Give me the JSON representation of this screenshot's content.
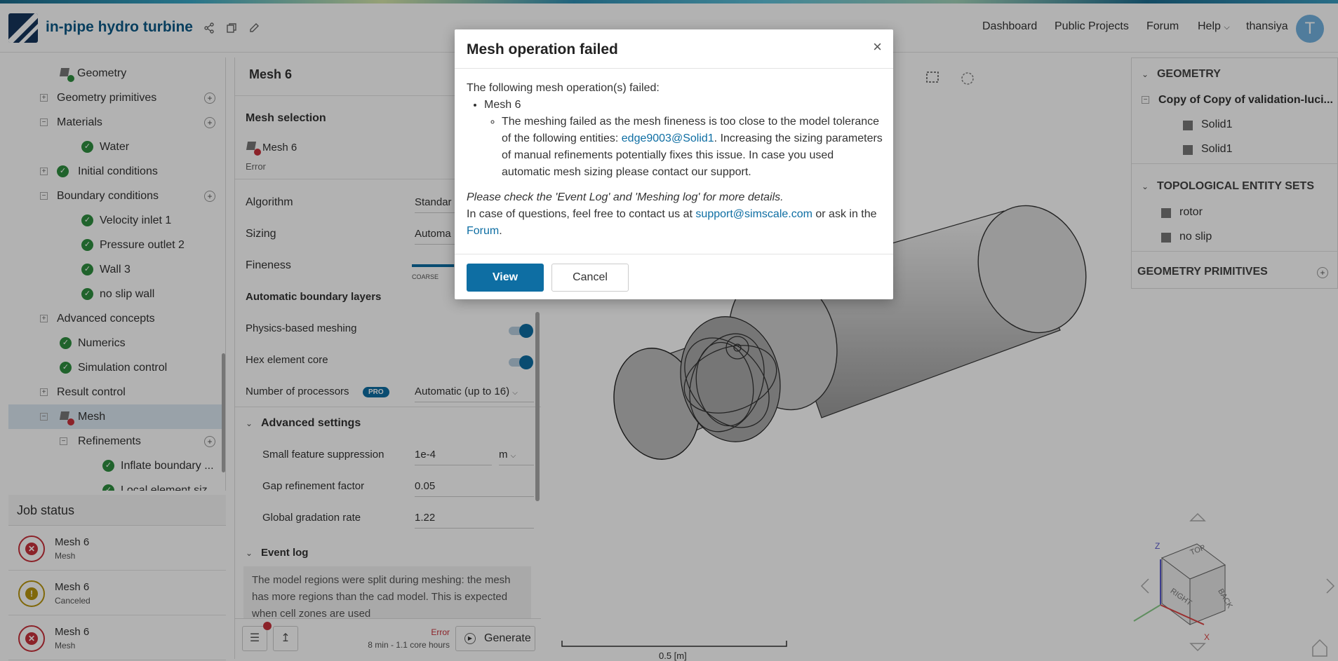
{
  "header": {
    "project_title": "in-pipe hydro turbine",
    "nav": [
      "Dashboard",
      "Public Projects",
      "Forum",
      "Help",
      "thansiya"
    ],
    "avatar_initial": "T"
  },
  "tree": {
    "items": [
      {
        "label": "Geometry"
      },
      {
        "label": "Geometry primitives"
      },
      {
        "label": "Materials"
      },
      {
        "label": "Water"
      },
      {
        "label": "Initial conditions"
      },
      {
        "label": "Boundary conditions"
      },
      {
        "label": "Velocity inlet 1"
      },
      {
        "label": "Pressure outlet 2"
      },
      {
        "label": "Wall 3"
      },
      {
        "label": "no slip wall"
      },
      {
        "label": "Advanced concepts"
      },
      {
        "label": "Numerics"
      },
      {
        "label": "Simulation control"
      },
      {
        "label": "Result control"
      },
      {
        "label": "Mesh"
      },
      {
        "label": "Refinements"
      },
      {
        "label": "Inflate boundary ..."
      },
      {
        "label": "Local element siz..."
      }
    ]
  },
  "job_status": {
    "title": "Job status",
    "jobs": [
      {
        "name": "Mesh 6",
        "sub": "Mesh",
        "state": "error"
      },
      {
        "name": "Mesh 6",
        "sub": "Canceled",
        "state": "warning"
      },
      {
        "name": "Mesh 6",
        "sub": "Mesh",
        "state": "error"
      }
    ]
  },
  "mesh_panel": {
    "title": "Mesh 6",
    "mesh_selection_label": "Mesh selection",
    "selected_mesh": "Mesh 6",
    "selected_status": "Error",
    "algorithm_label": "Algorithm",
    "algorithm_value": "Standar",
    "sizing_label": "Sizing",
    "sizing_value": "Automa",
    "fineness_label": "Fineness",
    "fineness_scale_left": "COARSE",
    "auto_boundary_layers_label": "Automatic boundary layers",
    "physics_meshing_label": "Physics-based meshing",
    "hex_core_label": "Hex element core",
    "processors_label": "Number of processors",
    "pro_badge": "PRO",
    "processors_value": "Automatic (up to 16)",
    "advanced_settings_label": "Advanced settings",
    "small_feature_label": "Small feature suppression",
    "small_feature_value": "1e-4",
    "small_feature_unit": "m",
    "gap_refinement_label": "Gap refinement factor",
    "gap_refinement_value": "0.05",
    "gradation_label": "Global gradation rate",
    "gradation_value": "1.22",
    "event_log_label": "Event log",
    "event_log_text": "The model regions were split during meshing: the mesh has more regions than the cad model. This is expected when cell zones are used",
    "footer_status": "Error",
    "footer_time": "8 min - 1.1 core hours",
    "generate_label": "Generate"
  },
  "right_panel": {
    "geometry_title": "GEOMETRY",
    "geometry_root": "Copy of Copy of validation-luci...",
    "solids": [
      "Solid1",
      "Solid1"
    ],
    "topo_title": "TOPOLOGICAL ENTITY SETS",
    "topo_items": [
      "rotor",
      "no slip"
    ],
    "primitives_title": "GEOMETRY PRIMITIVES"
  },
  "viewer": {
    "scale_label": "0.5 [m]",
    "nav_cube_faces": [
      "TOP",
      "RIGHT",
      "BACK"
    ],
    "axes": [
      "Z",
      "X"
    ]
  },
  "modal": {
    "title": "Mesh operation failed",
    "close": "×",
    "intro": "The following mesh operation(s) failed:",
    "op_name": "Mesh 6",
    "detail_pre": "The meshing failed as the mesh fineness is too close to the model tolerance of the following entities: ",
    "detail_link": "edge9003@Solid1",
    "detail_post": ". Increasing the sizing parameters of manual refinements potentially fixes this issue. In case you used automatic mesh sizing please contact our support.",
    "hint": "Please check the 'Event Log' and 'Meshing log' for more details.",
    "contact_pre": "In case of questions, feel free to contact us at ",
    "contact_email": "support@simscale.com",
    "contact_mid": " or ask in the ",
    "contact_forum": "Forum",
    "contact_end": ".",
    "view_label": "View",
    "cancel_label": "Cancel"
  },
  "colors": {
    "accent": "#0e6ea3",
    "success": "#2f8f3f",
    "error": "#c8323b",
    "warning": "#b8960f"
  }
}
